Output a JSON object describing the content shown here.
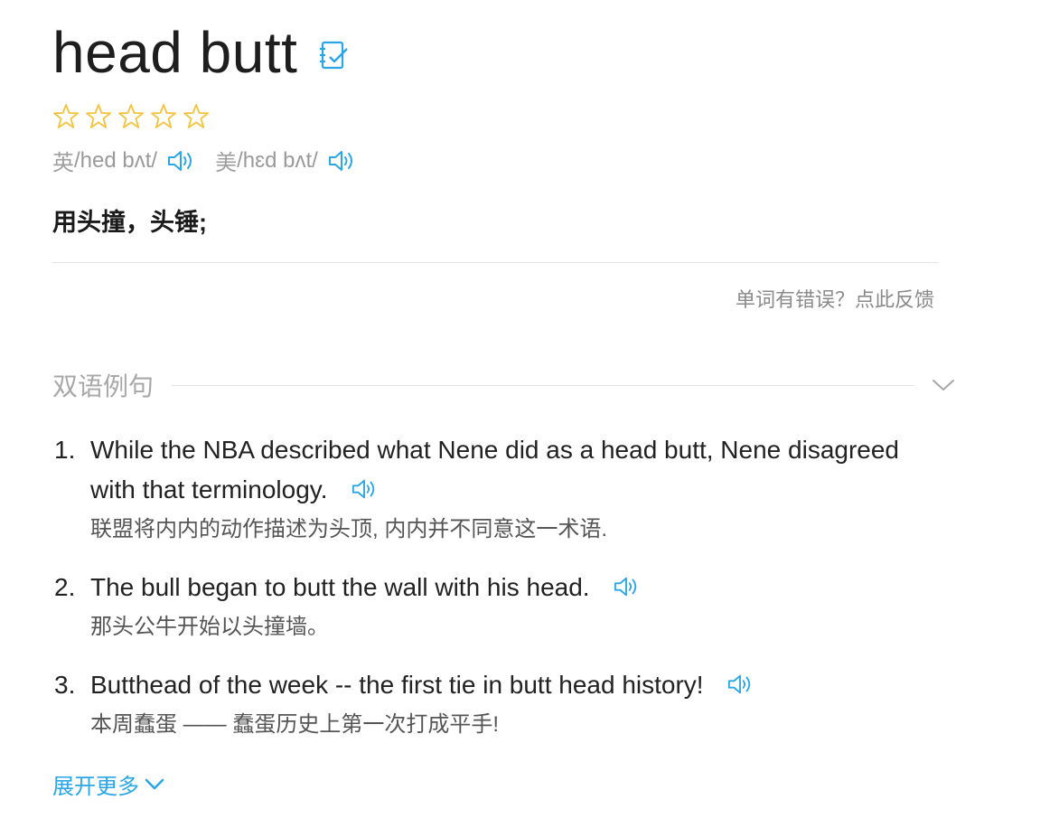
{
  "entry": {
    "word": "head butt",
    "rating_stars_total": 5,
    "rating_stars_filled": 0,
    "colors": {
      "accent": "#2aa6e6",
      "star": "#f5c23c"
    }
  },
  "phonetics": [
    {
      "lang": "英",
      "ipa": "/hed bʌt/"
    },
    {
      "lang": "美",
      "ipa": "/hɛd bʌt/"
    }
  ],
  "definition": "用头撞，头锤;",
  "feedback_link": "单词有错误？点此反馈",
  "examples_section": {
    "title": "双语例句",
    "items": [
      {
        "num": "1.",
        "en": "While the NBA described what Nene did as a head butt, Nene disagreed with that terminology.",
        "zh": "联盟将内内的动作描述为头顶, 内内并不同意这一术语."
      },
      {
        "num": "2.",
        "en": "The bull began to butt the wall with his head.",
        "zh": "那头公牛开始以头撞墙。"
      },
      {
        "num": "3.",
        "en": "Butthead of the week -- the first tie in butt head history!",
        "zh": "本周蠢蛋 —— 蠢蛋历史上第一次打成平手!"
      }
    ],
    "expand_label": "展开更多"
  },
  "icons": {
    "wordbook": "add-to-wordbook-icon",
    "speaker": "speaker-icon",
    "star": "star-outline-icon",
    "collapse": "chevron-down-icon"
  }
}
